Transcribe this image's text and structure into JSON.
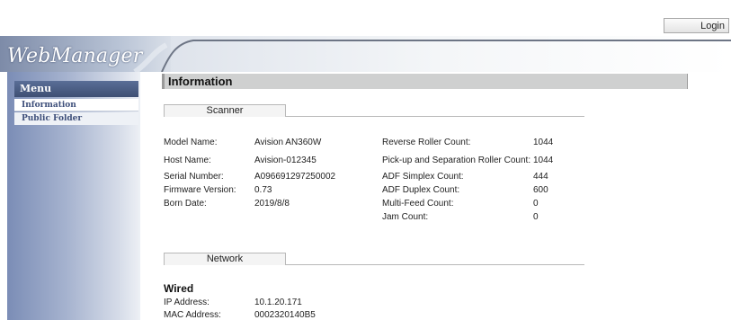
{
  "topbar": {
    "login_label": "Login"
  },
  "header": {
    "logo_text": "WebManager"
  },
  "sidebar": {
    "menu_title": "Menu",
    "items": [
      {
        "label": "Information",
        "active": true
      },
      {
        "label": "Public Folder",
        "active": false
      }
    ]
  },
  "main": {
    "section_title": "Information",
    "scanner_tab": "Scanner",
    "scanner_left": [
      {
        "label": "Model Name:",
        "value": "Avision AN360W"
      },
      {
        "label": "Host Name:",
        "value": "Avision-012345"
      },
      {
        "label": "Serial Number:",
        "value": "A096691297250002"
      },
      {
        "label": "Firmware Version:",
        "value": "0.73"
      },
      {
        "label": "Born Date:",
        "value": "2019/8/8"
      }
    ],
    "scanner_right": [
      {
        "label": "Reverse Roller Count:",
        "value": "1044"
      },
      {
        "label": "Pick-up and Separation Roller Count:",
        "value": "1044"
      },
      {
        "label": "ADF Simplex Count:",
        "value": "444"
      },
      {
        "label": "ADF Duplex Count:",
        "value": "600"
      },
      {
        "label": "Multi-Feed Count:",
        "value": "0"
      },
      {
        "label": "Jam Count:",
        "value": "0"
      }
    ],
    "network_tab": "Network",
    "wired_heading": "Wired",
    "network_rows": [
      {
        "label": "IP Address:",
        "value": "10.1.20.171"
      },
      {
        "label": "MAC Address:",
        "value": "0002320140B5"
      }
    ]
  }
}
